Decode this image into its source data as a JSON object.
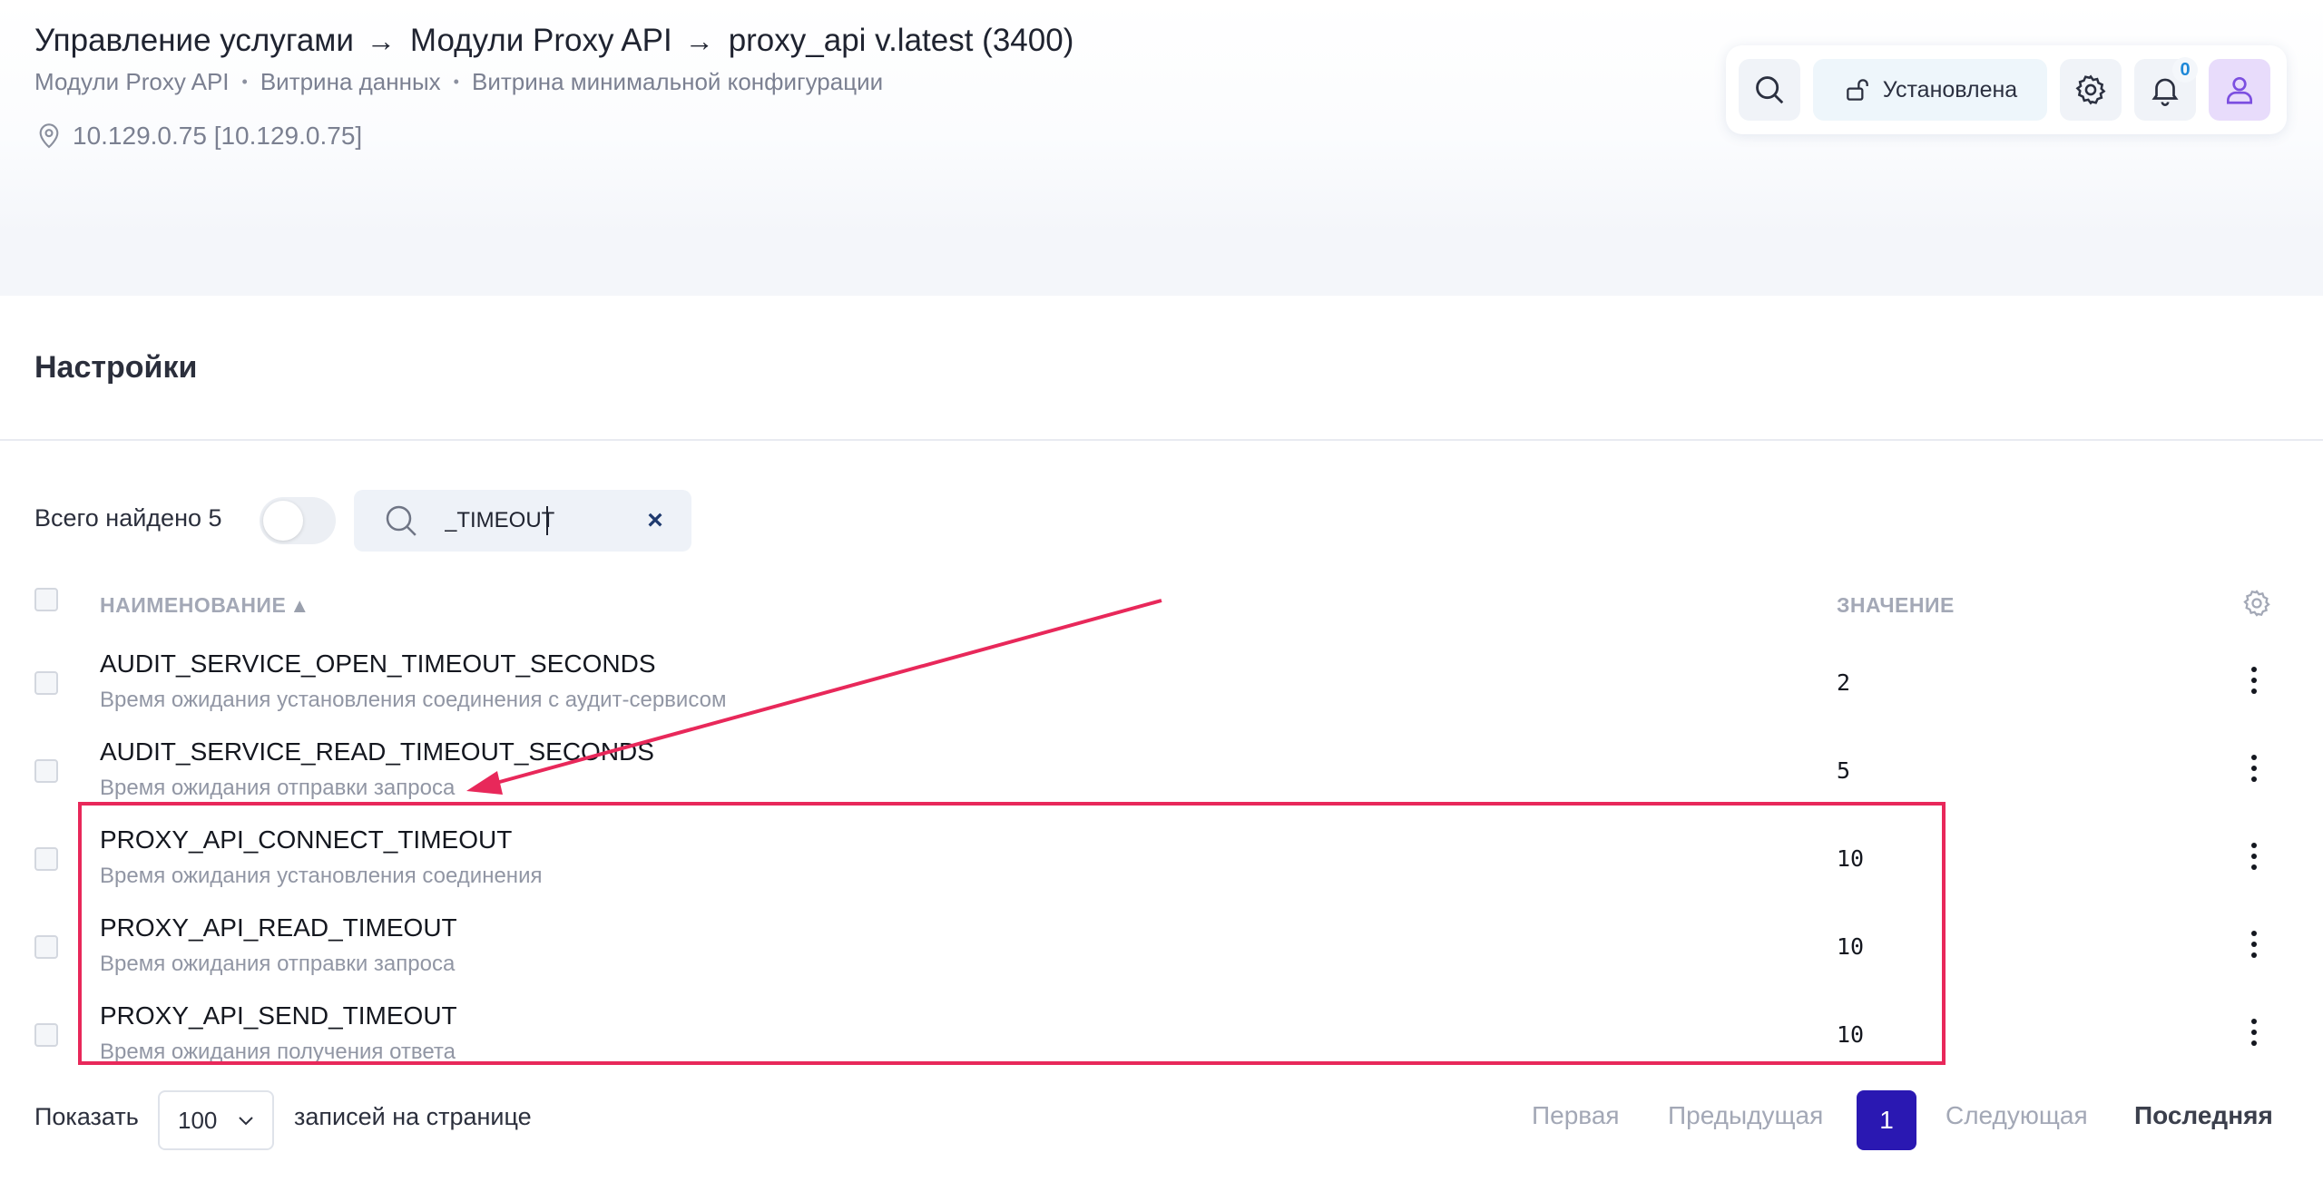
{
  "header": {
    "breadcrumb": [
      "Управление услугами",
      "Модули Proxy API",
      "proxy_api v.latest (3400)"
    ],
    "breadcrumb_separator": "→",
    "tags": [
      "Модули Proxy API",
      "Витрина данных",
      "Витрина минимальной конфигурации"
    ],
    "tag_separator": "•",
    "address": "10.129.0.75 [10.129.0.75]"
  },
  "toolbar": {
    "status_label": "Установлена",
    "notifications_count": "0",
    "icons": [
      "search-icon",
      "unlock-icon",
      "gear-icon",
      "bell-icon",
      "user-icon"
    ]
  },
  "settings": {
    "title": "Настройки",
    "found_label": "Всего найдено 5",
    "search_value": "_TIMEOUT",
    "clear_symbol": "×",
    "columns": {
      "name": "НАИМЕНОВАНИЕ",
      "value": "ЗНАЧЕНИЕ"
    },
    "sort_symbol": "▲",
    "rows": [
      {
        "name": "AUDIT_SERVICE_OPEN_TIMEOUT_SECONDS",
        "description": "Время ожидания установления соединения с аудит-сервисом",
        "value": "2"
      },
      {
        "name": "AUDIT_SERVICE_READ_TIMEOUT_SECONDS",
        "description": "Время ожидания отправки запроса",
        "value": "5"
      },
      {
        "name": "PROXY_API_CONNECT_TIMEOUT",
        "description": "Время ожидания установления соединения",
        "value": "10"
      },
      {
        "name": "PROXY_API_READ_TIMEOUT",
        "description": "Время ожидания отправки запроса",
        "value": "10"
      },
      {
        "name": "PROXY_API_SEND_TIMEOUT",
        "description": "Время ожидания получения ответа",
        "value": "10"
      }
    ]
  },
  "pagination": {
    "show_label": "Показать",
    "per_page": "100",
    "per_page_suffix": "записей на странице",
    "first": "Первая",
    "prev": "Предыдущая",
    "current": "1",
    "next": "Следующая",
    "last": "Последняя"
  },
  "annotation": {
    "color": "#e8285a"
  }
}
